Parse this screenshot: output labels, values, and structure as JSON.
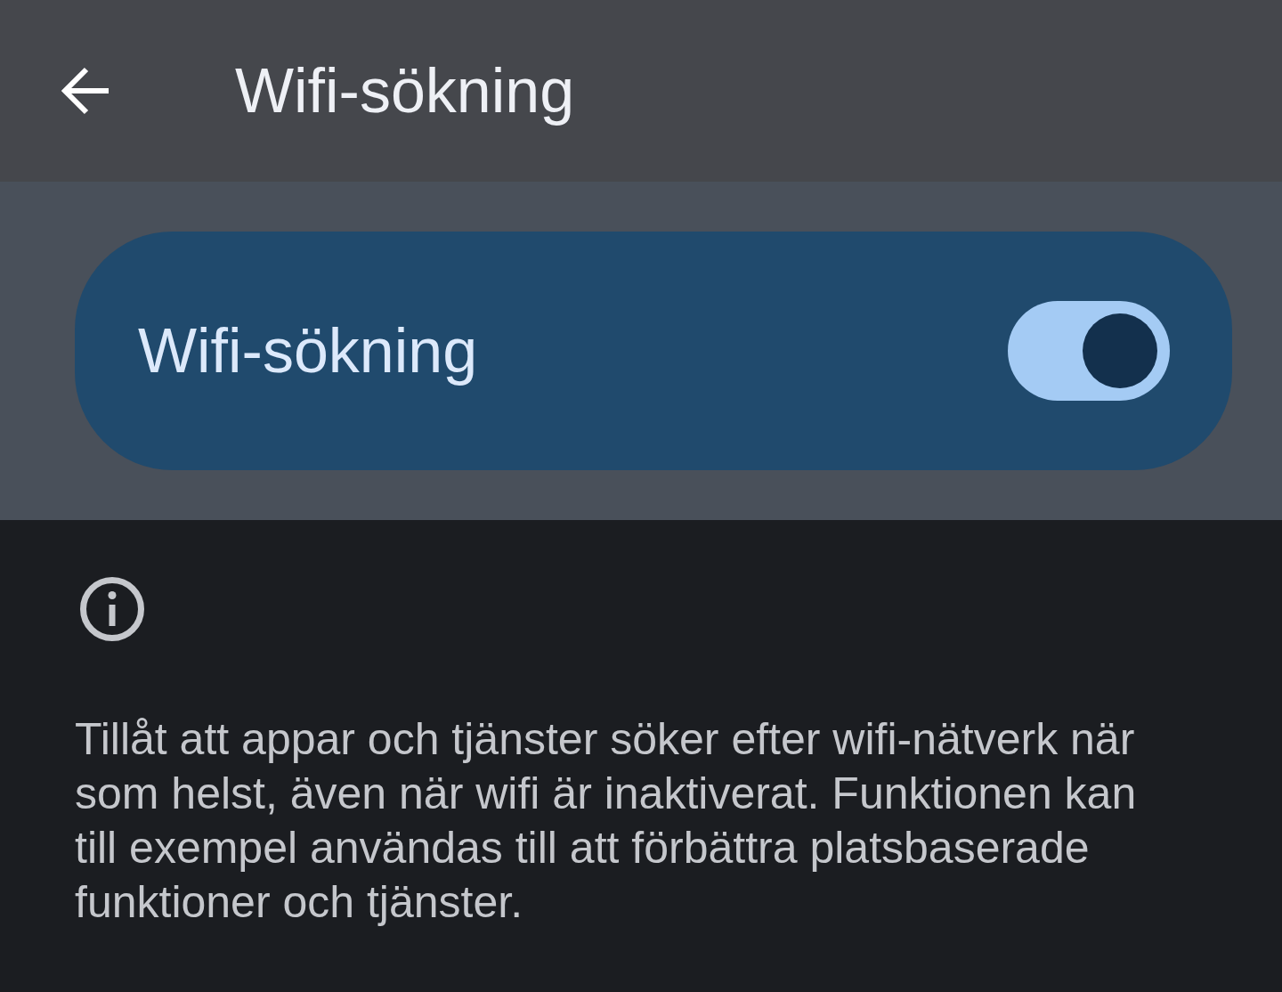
{
  "app_bar": {
    "title": "Wifi-sökning"
  },
  "main_switch": {
    "label": "Wifi-sökning",
    "on": true
  },
  "info": {
    "text": "Tillåt att appar och tjänster söker efter wifi-nätverk när som helst, även när wifi är inaktiverat. Funktionen kan till exempel användas till att förbättra platsbaserade funktioner och tjänster."
  }
}
